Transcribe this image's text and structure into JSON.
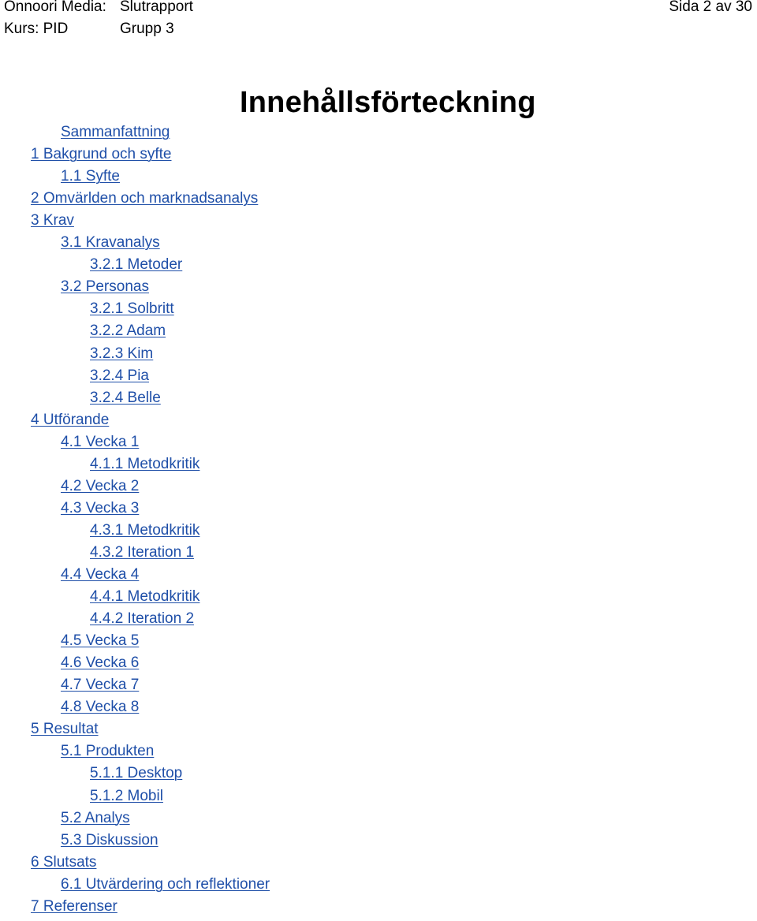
{
  "header": {
    "company_label": "Onnoori Media:",
    "report_label": "Slutrapport",
    "course_label": "Kurs: PID",
    "group_label": "Grupp 3",
    "page_indicator": "Sida 2 av 30"
  },
  "title": "Innehållsförteckning",
  "link_color": "#1f4fa8",
  "toc": [
    {
      "label": "Sammanfattning",
      "level": 2
    },
    {
      "label": "1 Bakgrund och syfte",
      "level": 1
    },
    {
      "label": "1.1 Syfte",
      "level": 2
    },
    {
      "label": "2 Omvärlden och marknadsanalys",
      "level": 1
    },
    {
      "label": "3 Krav",
      "level": 1
    },
    {
      "label": "3.1 Kravanalys",
      "level": 2
    },
    {
      "label": "3.2.1 Metoder",
      "level": 3
    },
    {
      "label": "3.2 Personas",
      "level": 2
    },
    {
      "label": "3.2.1 Solbritt",
      "level": 3
    },
    {
      "label": "3.2.2 Adam",
      "level": 3
    },
    {
      "label": "3.2.3 Kim",
      "level": 3
    },
    {
      "label": "3.2.4 Pia",
      "level": 3
    },
    {
      "label": "3.2.4 Belle",
      "level": 3
    },
    {
      "label": "4 Utförande",
      "level": 1
    },
    {
      "label": "4.1 Vecka 1",
      "level": 2
    },
    {
      "label": "4.1.1 Metodkritik",
      "level": 3
    },
    {
      "label": "4.2 Vecka 2",
      "level": 2
    },
    {
      "label": "4.3 Vecka 3",
      "level": 2
    },
    {
      "label": "4.3.1 Metodkritik",
      "level": 3
    },
    {
      "label": "4.3.2 Iteration 1",
      "level": 3
    },
    {
      "label": "4.4 Vecka 4",
      "level": 2
    },
    {
      "label": "4.4.1 Metodkritik",
      "level": 3
    },
    {
      "label": "4.4.2 Iteration 2",
      "level": 3
    },
    {
      "label": "4.5 Vecka 5",
      "level": 2
    },
    {
      "label": "4.6 Vecka 6",
      "level": 2
    },
    {
      "label": "4.7 Vecka 7",
      "level": 2
    },
    {
      "label": "4.8 Vecka 8",
      "level": 2
    },
    {
      "label": "5 Resultat",
      "level": 1
    },
    {
      "label": "5.1 Produkten",
      "level": 2
    },
    {
      "label": "5.1.1 Desktop",
      "level": 3
    },
    {
      "label": "5.1.2 Mobil",
      "level": 3
    },
    {
      "label": "5.2 Analys",
      "level": 2
    },
    {
      "label": "5.3 Diskussion",
      "level": 2
    },
    {
      "label": "6 Slutsats",
      "level": 1
    },
    {
      "label": "6.1 Utvärdering och reflektioner",
      "level": 2
    },
    {
      "label": "7 Referenser",
      "level": 1
    }
  ]
}
